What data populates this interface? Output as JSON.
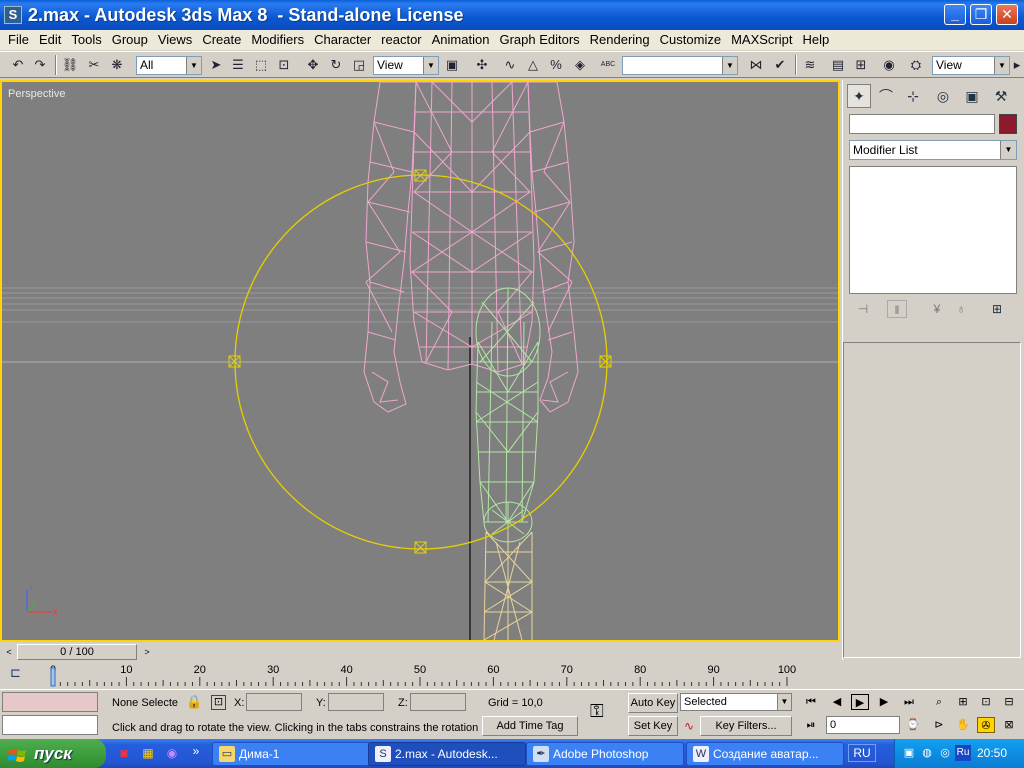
{
  "window": {
    "title": "2.max - Autodesk 3ds Max 8  - Stand-alone License",
    "app_icon": "S",
    "min_glyph": "_",
    "max_glyph": "❐",
    "close_glyph": "✕"
  },
  "menu": [
    "File",
    "Edit",
    "Tools",
    "Group",
    "Views",
    "Create",
    "Modifiers",
    "Character",
    "reactor",
    "Animation",
    "Graph Editors",
    "Rendering",
    "Customize",
    "MAXScript",
    "Help"
  ],
  "toolbar": {
    "selection_filter": "All",
    "ref_coord": "View",
    "named_sets": "",
    "render_view": "View",
    "abc_label": "ABC"
  },
  "viewport": {
    "label": "Perspective",
    "axis_z": "z",
    "axis_x": "x",
    "border_color": "#ffd400",
    "bg_color": "#7f7f7f"
  },
  "command_panel": {
    "object_name": "",
    "object_color": "#8b1a2c",
    "modifier_list": "Modifier List"
  },
  "time_slider": {
    "frame_display": "0 / 100",
    "prev": "<",
    "next": ">",
    "ticks": [
      "0",
      "10",
      "20",
      "30",
      "40",
      "50",
      "60",
      "70",
      "80",
      "90",
      "100"
    ]
  },
  "status": {
    "selection_text": "None Selecte",
    "x_label": "X:",
    "y_label": "Y:",
    "z_label": "Z:",
    "x_value": "",
    "y_value": "",
    "z_value": "",
    "grid": "Grid = 10,0",
    "add_time_tag": "Add Time Tag",
    "prompt": "Click and drag to rotate the view.  Clicking in the tabs constrains the rotation",
    "auto_key": "Auto Key",
    "set_key": "Set Key",
    "key_mode": "Selected",
    "key_filters": "Key Filters...",
    "current_frame": "0"
  },
  "taskbar": {
    "start_label": "пуск",
    "more": "»",
    "tasks": [
      {
        "label": "Дима-1",
        "icon": "folder-icon"
      },
      {
        "label": "2.max - Autodesk...",
        "icon": "max-icon"
      },
      {
        "label": "Adobe Photoshop",
        "icon": "photoshop-icon"
      },
      {
        "label": "Создание аватар...",
        "icon": "word-icon"
      }
    ],
    "language": "RU",
    "tray_lang": "Ru",
    "clock": "20:50"
  }
}
